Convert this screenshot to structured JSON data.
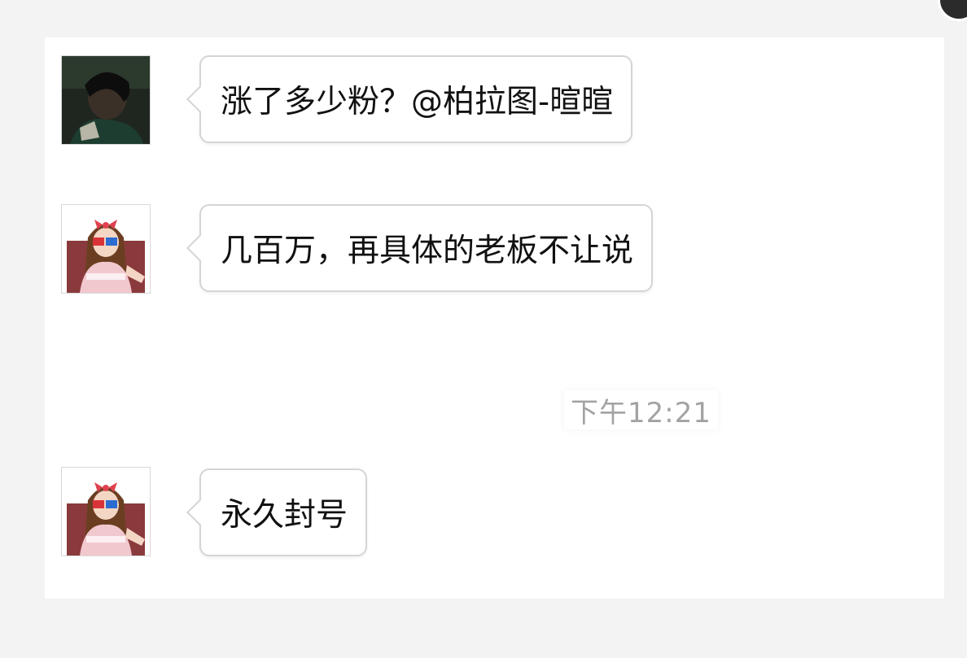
{
  "messages": [
    {
      "sender": "user",
      "text": "涨了多少粉？@柏拉图-暄暄"
    },
    {
      "sender": "other",
      "text": "几百万，再具体的老板不让说"
    },
    {
      "sender": "other",
      "text": "永久封号"
    }
  ],
  "timestamp": "下午12:21",
  "colors": {
    "page_background": "#f3f3f4",
    "chat_background": "#ffffff",
    "bubble_border": "#d5d5d5",
    "timestamp_text": "#a3a3a3"
  }
}
